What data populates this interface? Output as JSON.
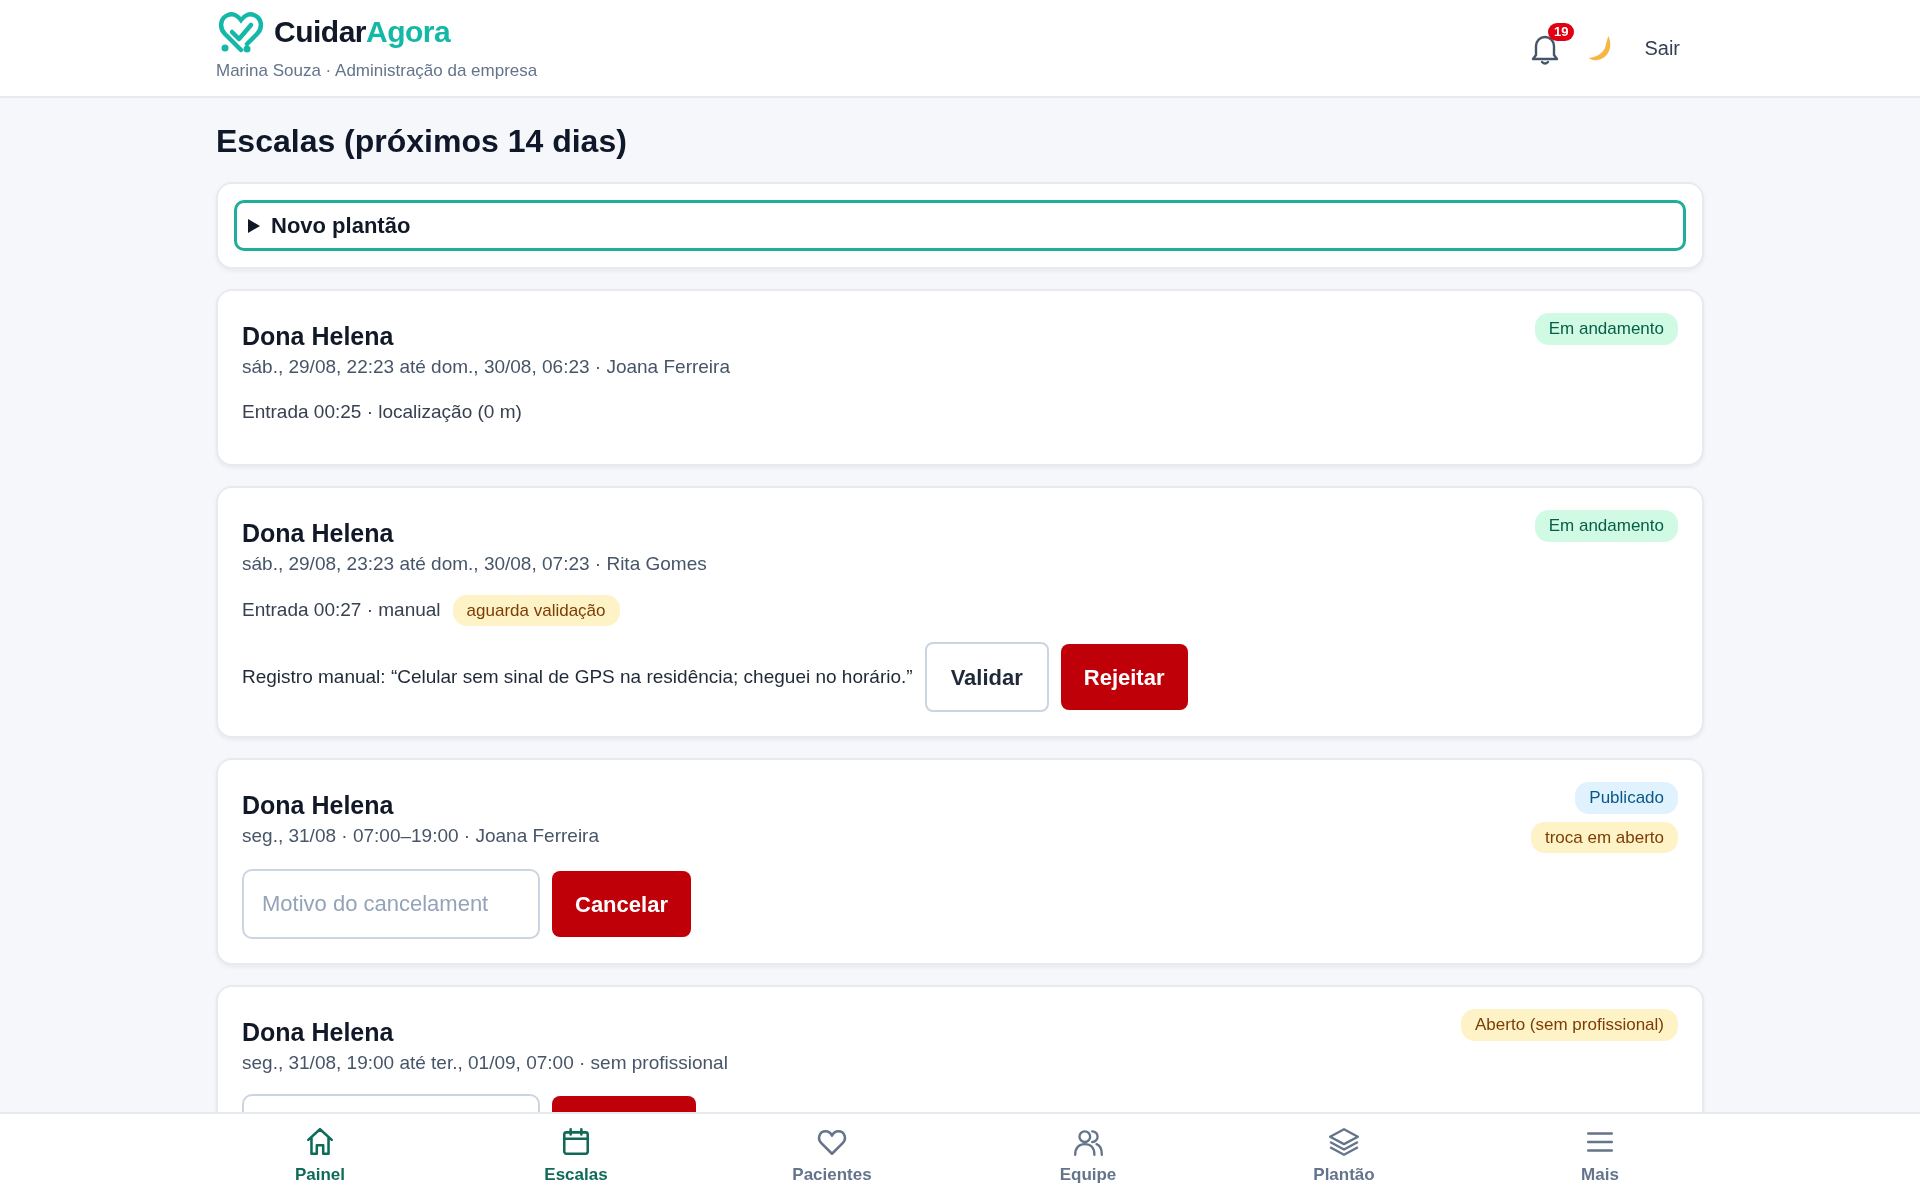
{
  "header": {
    "brand": {
      "first": "Cuidar",
      "second": "Agora"
    },
    "subtitle": "Marina Souza · Administração da empresa",
    "notifications": "19",
    "logout": "Sair"
  },
  "page_title": "Escalas (próximos 14 dias)",
  "new_shift": {
    "label": "Novo plantão",
    "expanded": false,
    "focused": true
  },
  "shifts": [
    {
      "patient": "Dona Helena",
      "schedule": "sáb., 29/08, 22:23 até dom., 30/08, 06:23 · Joana Ferreira",
      "badges": [
        {
          "label": "Em andamento",
          "kind": "success"
        }
      ],
      "entry": {
        "text": "Entrada 00:25 · localização (0 m)"
      }
    },
    {
      "patient": "Dona Helena",
      "schedule": "sáb., 29/08, 23:23 até dom., 30/08, 07:23 · Rita Gomes",
      "badges": [
        {
          "label": "Em andamento",
          "kind": "success"
        }
      ],
      "entry": {
        "text": "Entrada 00:27 · manual",
        "tag": "aguarda validação"
      },
      "actions": {
        "kind": "validate",
        "note": "Registro manual: “Celular sem sinal de GPS na residência; cheguei no horário.”",
        "approve": "Validar",
        "reject": "Rejeitar"
      }
    },
    {
      "patient": "Dona Helena",
      "schedule": "seg., 31/08 · 07:00–19:00 · Joana Ferreira",
      "badges": [
        {
          "label": "Publicado",
          "kind": "info"
        },
        {
          "label": "troca em aberto",
          "kind": "warning"
        }
      ],
      "actions": {
        "kind": "cancel",
        "placeholder": "Motivo do cancelament",
        "button": "Cancelar"
      }
    },
    {
      "patient": "Dona Helena",
      "schedule": "seg., 31/08, 19:00 até ter., 01/09, 07:00 · sem profissional",
      "badges": [
        {
          "label": "Aberto (sem profissional)",
          "kind": "warning"
        }
      ],
      "actions": {
        "kind": "cancel"
      }
    }
  ],
  "bottom_nav": [
    {
      "label": "Painel",
      "selected": true
    },
    {
      "label": "Escalas",
      "selected": true
    },
    {
      "label": "Pacientes",
      "selected": false
    },
    {
      "label": "Equipe",
      "selected": false
    },
    {
      "label": "Plantão",
      "selected": false
    },
    {
      "label": "Mais",
      "selected": false
    }
  ]
}
